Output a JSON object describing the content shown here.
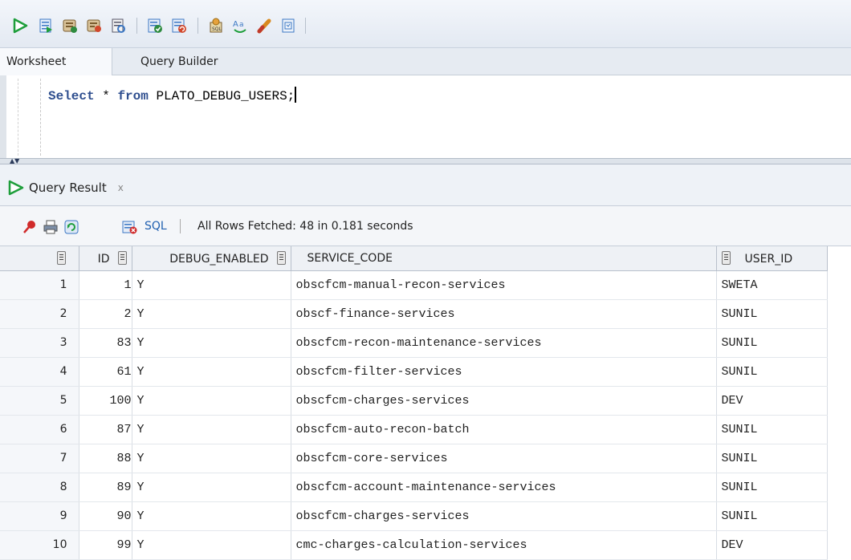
{
  "toolbar": {
    "icons": [
      "run-statement-icon",
      "run-script-icon",
      "autotrace-icon",
      "explain-plan-icon",
      "sql-tuning-advisor-icon",
      "commit-icon",
      "rollback-icon",
      "unshared-sql-worksheet-icon",
      "format-case-icon",
      "clear-icon",
      "sql-history-icon"
    ],
    "colors": {
      "run": "#1e9e3b",
      "doc": "#3b77c4",
      "db": "#7a5c2e",
      "accent": "#d2472b"
    }
  },
  "tabs": {
    "worksheet": "Worksheet",
    "query_builder": "Query Builder"
  },
  "editor": {
    "keyword_select": "Select",
    "star": "*",
    "keyword_from": "from",
    "table": "PLATO_DEBUG_USERS;"
  },
  "result": {
    "tab_label": "Query Result",
    "close": "x",
    "sql_label": "SQL",
    "fetch_status": "All Rows Fetched: 48 in 0.181 seconds",
    "columns": [
      "ID",
      "DEBUG_ENABLED",
      "SERVICE_CODE",
      "USER_ID"
    ],
    "rows": [
      {
        "n": "1",
        "id": "1",
        "enabled": "Y",
        "service": "obscfcm-manual-recon-services",
        "user": "SWETA"
      },
      {
        "n": "2",
        "id": "2",
        "enabled": "Y",
        "service": "obscf-finance-services",
        "user": "SUNIL"
      },
      {
        "n": "3",
        "id": "83",
        "enabled": "Y",
        "service": "obscfcm-recon-maintenance-services",
        "user": "SUNIL"
      },
      {
        "n": "4",
        "id": "61",
        "enabled": "Y",
        "service": "obscfcm-filter-services",
        "user": "SUNIL"
      },
      {
        "n": "5",
        "id": "100",
        "enabled": "Y",
        "service": "obscfcm-charges-services",
        "user": "DEV"
      },
      {
        "n": "6",
        "id": "87",
        "enabled": "Y",
        "service": "obscfcm-auto-recon-batch",
        "user": "SUNIL"
      },
      {
        "n": "7",
        "id": "88",
        "enabled": "Y",
        "service": "obscfcm-core-services",
        "user": "SUNIL"
      },
      {
        "n": "8",
        "id": "89",
        "enabled": "Y",
        "service": "obscfcm-account-maintenance-services",
        "user": "SUNIL"
      },
      {
        "n": "9",
        "id": "90",
        "enabled": "Y",
        "service": "obscfcm-charges-services",
        "user": "SUNIL"
      },
      {
        "n": "10",
        "id": "99",
        "enabled": "Y",
        "service": "cmc-charges-calculation-services",
        "user": "DEV"
      }
    ]
  }
}
